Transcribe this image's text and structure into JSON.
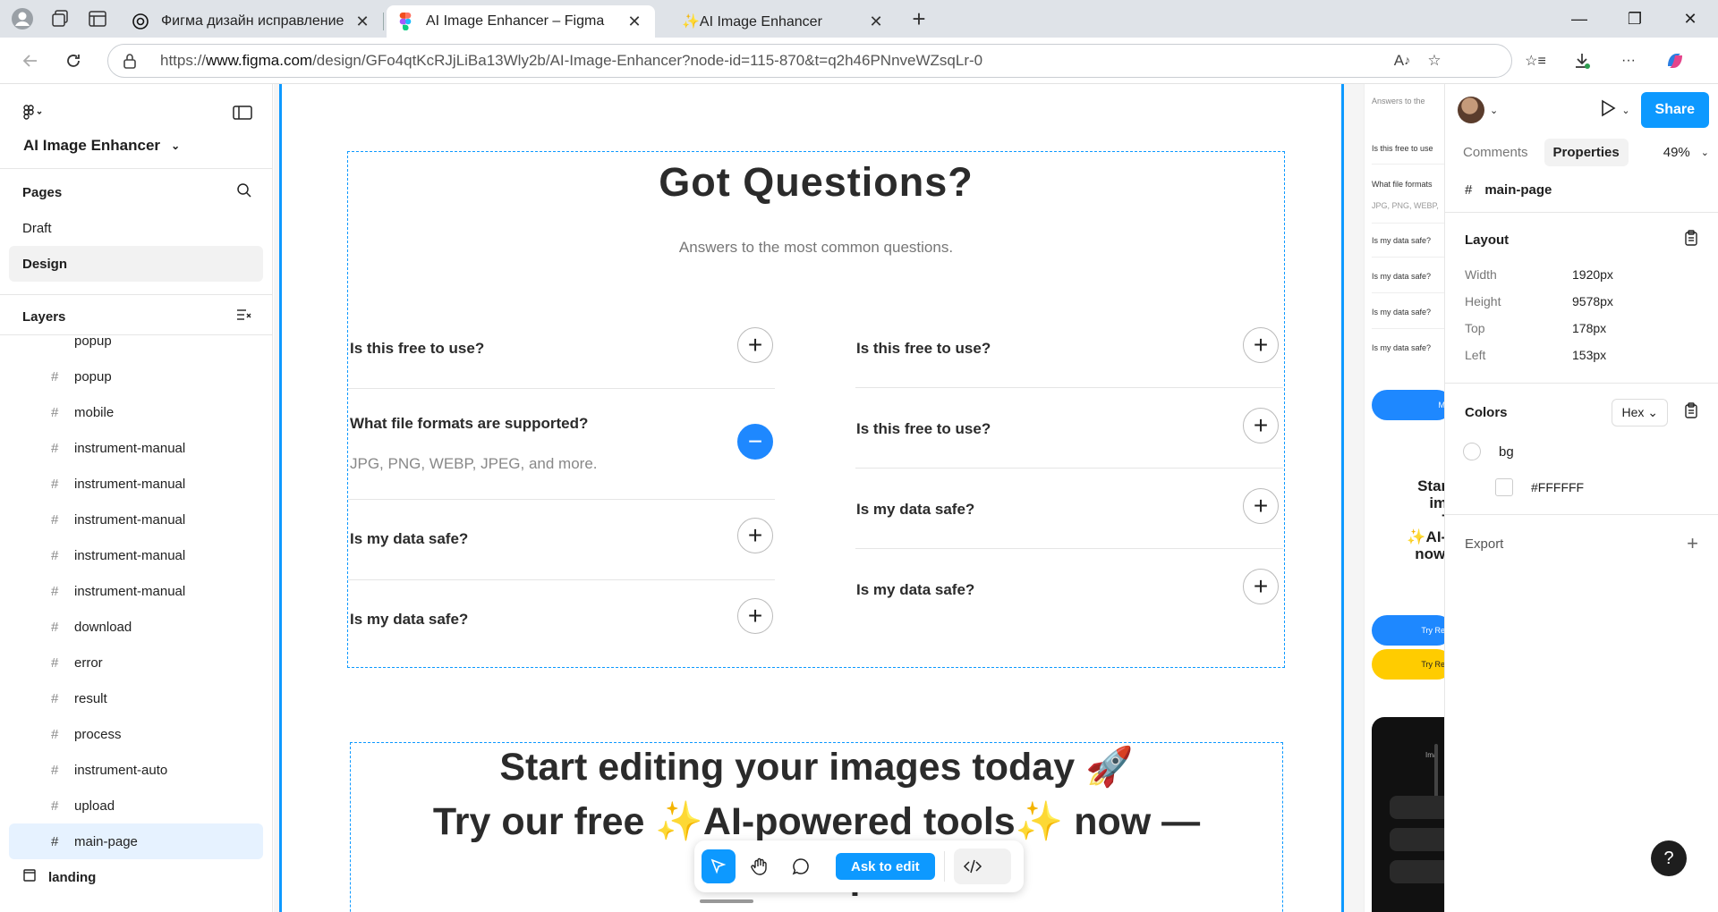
{
  "browser": {
    "tabs": [
      {
        "title": "Фигма дизайн исправление",
        "active": false
      },
      {
        "title": "AI Image Enhancer – Figma",
        "active": true
      },
      {
        "title": "✨AI Image Enhancer",
        "active": false
      }
    ],
    "url_prefix": "https://",
    "url_domain": "www.figma.com",
    "url_path": "/design/GFo4qtKcRJjLiBa13Wly2b/AI-Image-Enhancer?node-id=115-870&t=q2h46PNnveWZsqLr-0",
    "accent": "#0d99ff"
  },
  "left_panel": {
    "project_name": "AI Image Enhancer",
    "pages_header": "Pages",
    "pages": [
      {
        "name": "Draft",
        "selected": false
      },
      {
        "name": "Design",
        "selected": true
      }
    ],
    "layers_header": "Layers",
    "layers": [
      {
        "name": "popup",
        "selected": false
      },
      {
        "name": "popup",
        "selected": false
      },
      {
        "name": "mobile",
        "selected": false
      },
      {
        "name": "instrument-manual",
        "selected": false
      },
      {
        "name": "instrument-manual",
        "selected": false
      },
      {
        "name": "instrument-manual",
        "selected": false
      },
      {
        "name": "instrument-manual",
        "selected": false
      },
      {
        "name": "instrument-manual",
        "selected": false
      },
      {
        "name": "download",
        "selected": false
      },
      {
        "name": "error",
        "selected": false
      },
      {
        "name": "result",
        "selected": false
      },
      {
        "name": "process",
        "selected": false
      },
      {
        "name": "instrument-auto",
        "selected": false
      },
      {
        "name": "upload",
        "selected": false
      },
      {
        "name": "main-page",
        "selected": true
      }
    ],
    "section_page": "landing"
  },
  "canvas": {
    "faq": {
      "title": "Got Questions?",
      "subtitle": "Answers to the most common questions.",
      "left": [
        {
          "q": "Is this free to use?",
          "open": false,
          "a": ""
        },
        {
          "q": "What file formats are supported?",
          "open": true,
          "a": "JPG, PNG, WEBP, JPEG, and more."
        },
        {
          "q": "Is my data safe?",
          "open": false,
          "a": ""
        },
        {
          "q": "Is my data safe?",
          "open": false,
          "a": ""
        }
      ],
      "right": [
        {
          "q": "Is this free to use?",
          "open": false
        },
        {
          "q": "Is this free to use?",
          "open": false
        },
        {
          "q": "Is my data safe?",
          "open": false
        },
        {
          "q": "Is my data safe?",
          "open": false
        }
      ]
    },
    "cta": {
      "line1": "Start editing your images today 🚀",
      "line2": "Try our free ✨AI-powered tools✨  now —",
      "line3": "no s     p"
    },
    "preview": {
      "subtitle": "Answers to the",
      "items": [
        "Is this free to use",
        "What file formats",
        "JPG, PNG, WEBP,",
        "Is my data safe?",
        "Is my data safe?",
        "Is my data safe?",
        "Is my data safe?"
      ],
      "btn1": "M",
      "cta_lines": [
        "Start e",
        "imag",
        "Try",
        "✨AI-po",
        "now —",
        "n"
      ],
      "btn2": "Try Re",
      "btn3": "Try Re",
      "dark_label": "Ima"
    }
  },
  "toolbar": {
    "ask_label": "Ask to edit"
  },
  "right_panel": {
    "share_label": "Share",
    "tab_comments": "Comments",
    "tab_properties": "Properties",
    "zoom": "49%",
    "node_name": "main-page",
    "layout_header": "Layout",
    "props": [
      {
        "k": "Width",
        "v": "1920px"
      },
      {
        "k": "Height",
        "v": "9578px"
      },
      {
        "k": "Top",
        "v": "178px"
      },
      {
        "k": "Left",
        "v": "153px"
      }
    ],
    "colors_header": "Colors",
    "color_format": "Hex",
    "color_name": "bg",
    "color_value": "#FFFFFF",
    "export_header": "Export",
    "help": "?"
  }
}
